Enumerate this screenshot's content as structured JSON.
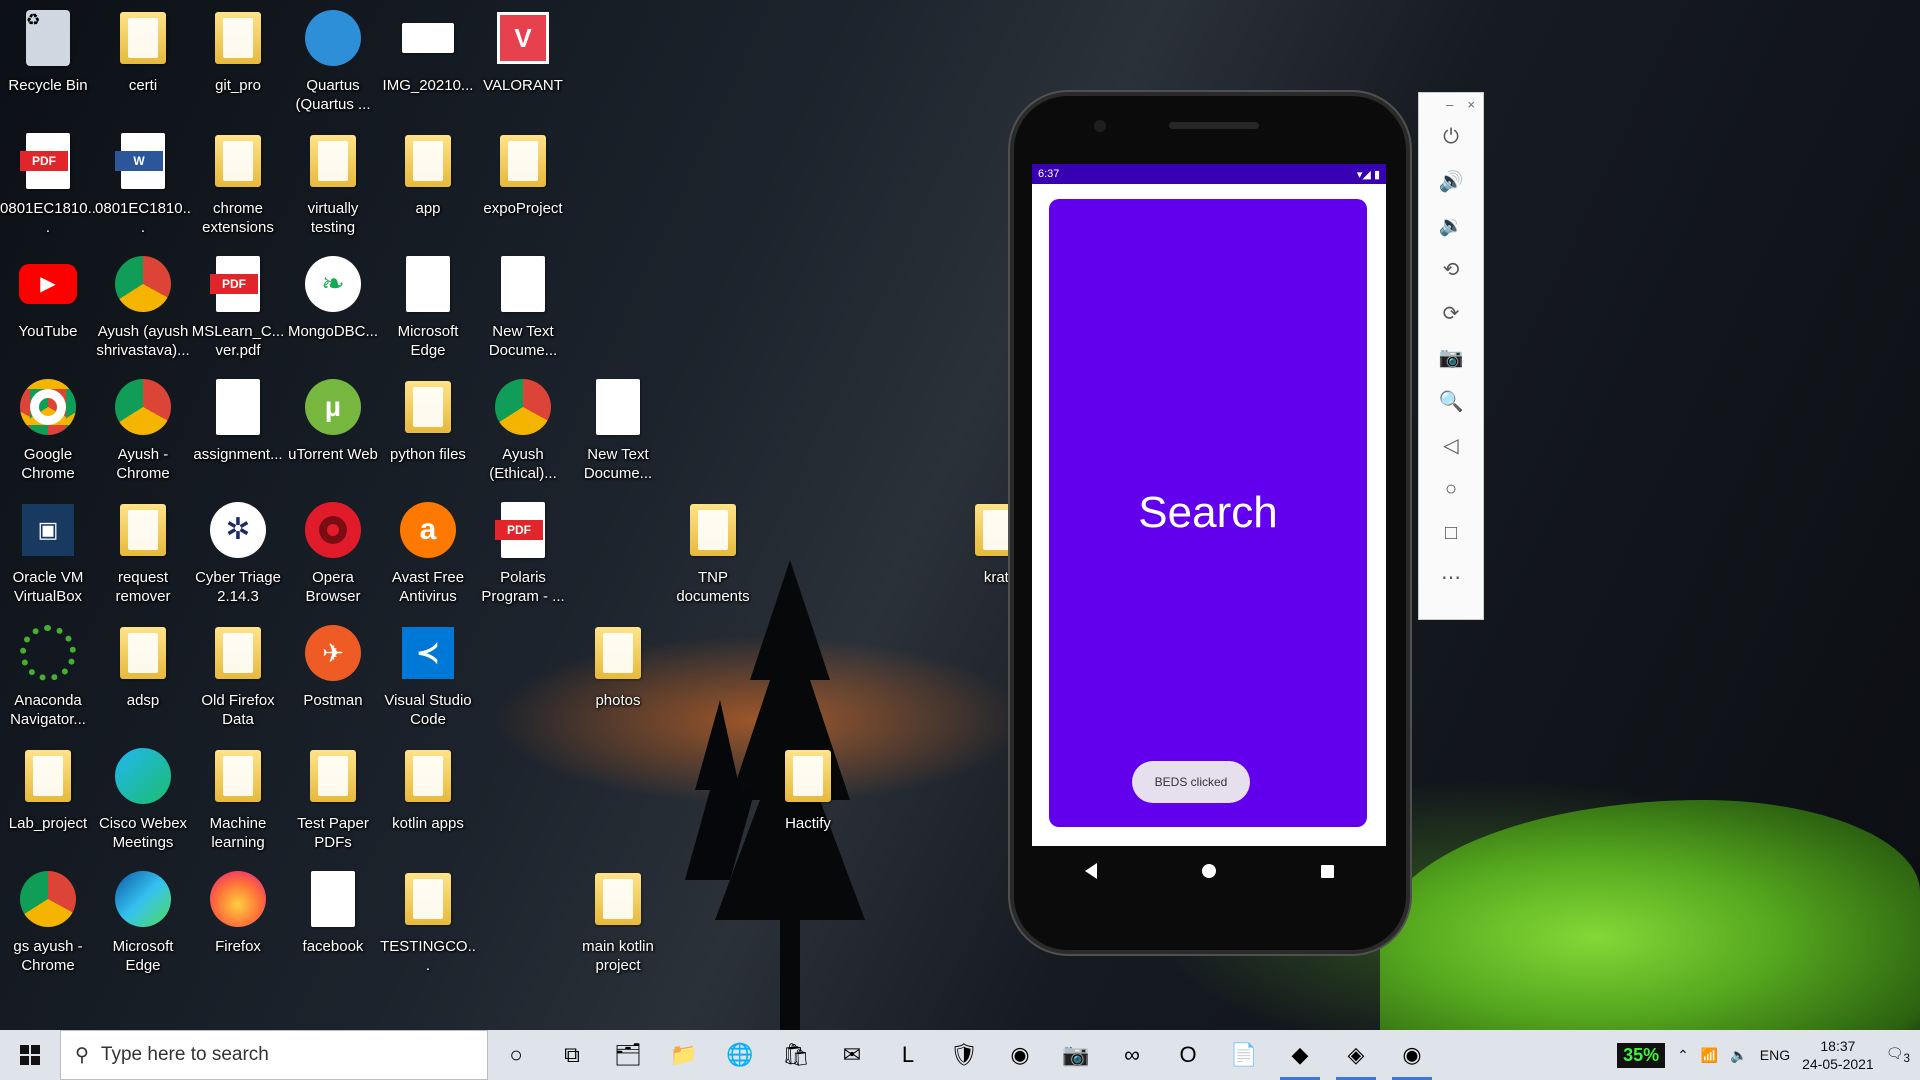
{
  "desktop_icons": [
    {
      "label": "Recycle Bin",
      "icon": "recycle-bin-icon"
    },
    {
      "label": "certi",
      "icon": "folder-icon"
    },
    {
      "label": "git_pro",
      "icon": "folder-icon"
    },
    {
      "label": "Quartus (Quartus ...",
      "icon": "quartus-icon"
    },
    {
      "label": "IMG_20210...",
      "icon": "image-file-icon"
    },
    {
      "label": "VALORANT",
      "icon": "valorant-icon"
    },
    {
      "label": "0801EC1810...",
      "icon": "pdf-icon"
    },
    {
      "label": "0801EC1810...",
      "icon": "word-doc-icon"
    },
    {
      "label": "chrome extensions",
      "icon": "folder-icon"
    },
    {
      "label": "virtually testing",
      "icon": "folder-icon"
    },
    {
      "label": "app",
      "icon": "folder-icon"
    },
    {
      "label": "expoProject",
      "icon": "folder-icon"
    },
    {
      "label": "YouTube",
      "icon": "youtube-icon"
    },
    {
      "label": "Ayush (ayush shrivastava)...",
      "icon": "chrome-profile-icon"
    },
    {
      "label": "MSLearn_C... ver.pdf",
      "icon": "pdf-icon"
    },
    {
      "label": "MongoDBC...",
      "icon": "mongodb-icon"
    },
    {
      "label": "Microsoft Edge",
      "icon": "file-icon"
    },
    {
      "label": "New Text Docume...",
      "icon": "text-file-icon"
    },
    {
      "label": "Google Chrome",
      "icon": "chrome-icon"
    },
    {
      "label": "Ayush - Chrome",
      "icon": "chrome-profile-icon"
    },
    {
      "label": "assignment...",
      "icon": "file-icon"
    },
    {
      "label": "uTorrent Web",
      "icon": "utorrent-icon"
    },
    {
      "label": "python files",
      "icon": "folder-icon"
    },
    {
      "label": "Ayush (Ethical)...",
      "icon": "chrome-profile-icon"
    },
    {
      "label": "New Text Docume...",
      "icon": "text-file-icon"
    },
    {
      "label": "Oracle VM VirtualBox",
      "icon": "virtualbox-icon"
    },
    {
      "label": "request remover",
      "icon": "folder-icon"
    },
    {
      "label": "Cyber Triage 2.14.3",
      "icon": "cyber-triage-icon"
    },
    {
      "label": "Opera Browser",
      "icon": "opera-icon"
    },
    {
      "label": "Avast Free Antivirus",
      "icon": "avast-icon"
    },
    {
      "label": "Polaris Program - ...",
      "icon": "pdf-icon"
    },
    {
      "label": "TNP documents",
      "icon": "folder-icon"
    },
    {
      "label": "krati",
      "icon": "folder-icon"
    },
    {
      "label": "Anaconda Navigator...",
      "icon": "anaconda-icon"
    },
    {
      "label": "adsp",
      "icon": "folder-icon"
    },
    {
      "label": "Old Firefox Data",
      "icon": "folder-icon"
    },
    {
      "label": "Postman",
      "icon": "postman-icon"
    },
    {
      "label": "Visual Studio Code",
      "icon": "vscode-icon"
    },
    {
      "label": "photos",
      "icon": "folder-icon"
    },
    {
      "label": "Lab_project",
      "icon": "folder-icon"
    },
    {
      "label": "Cisco Webex Meetings",
      "icon": "webex-icon"
    },
    {
      "label": "Machine learning",
      "icon": "folder-icon"
    },
    {
      "label": "Test Paper PDFs",
      "icon": "folder-icon"
    },
    {
      "label": "kotlin apps",
      "icon": "folder-icon"
    },
    {
      "label": "Hactify",
      "icon": "folder-icon"
    },
    {
      "label": "gs ayush - Chrome",
      "icon": "chrome-profile-icon"
    },
    {
      "label": "Microsoft Edge",
      "icon": "edge-icon"
    },
    {
      "label": "Firefox",
      "icon": "firefox-icon"
    },
    {
      "label": "facebook",
      "icon": "file-icon"
    },
    {
      "label": "TESTINGCO...",
      "icon": "folder-icon"
    },
    {
      "label": "main kotlin project",
      "icon": "folder-icon"
    }
  ],
  "emulator": {
    "status_time": "6:37",
    "app_text": "Search",
    "toast": "BEDS clicked",
    "toolbar_buttons": [
      "power-icon",
      "volume-up-icon",
      "volume-down-icon",
      "rotate-left-icon",
      "rotate-right-icon",
      "camera-icon",
      "zoom-icon",
      "back-icon",
      "home-icon",
      "overview-icon",
      "more-icon"
    ],
    "app_color": "#6200ee",
    "status_color": "#3700b3"
  },
  "taskbar": {
    "search_placeholder": "Type here to search",
    "battery": "35%",
    "language": "ENG",
    "time": "18:37",
    "date": "24-05-2021",
    "notifications": "3",
    "apps": [
      "task-view-icon",
      "file-explorer-icon",
      "folder-icon",
      "edge-icon",
      "store-icon",
      "mail-icon",
      "lens-icon",
      "mcafee-icon",
      "chrome-icon",
      "camera-icon",
      "arduino-icon",
      "opera-icon",
      "notepad-icon",
      "android-studio-icon",
      "emulator-icon",
      "chrome-profile-icon"
    ]
  }
}
